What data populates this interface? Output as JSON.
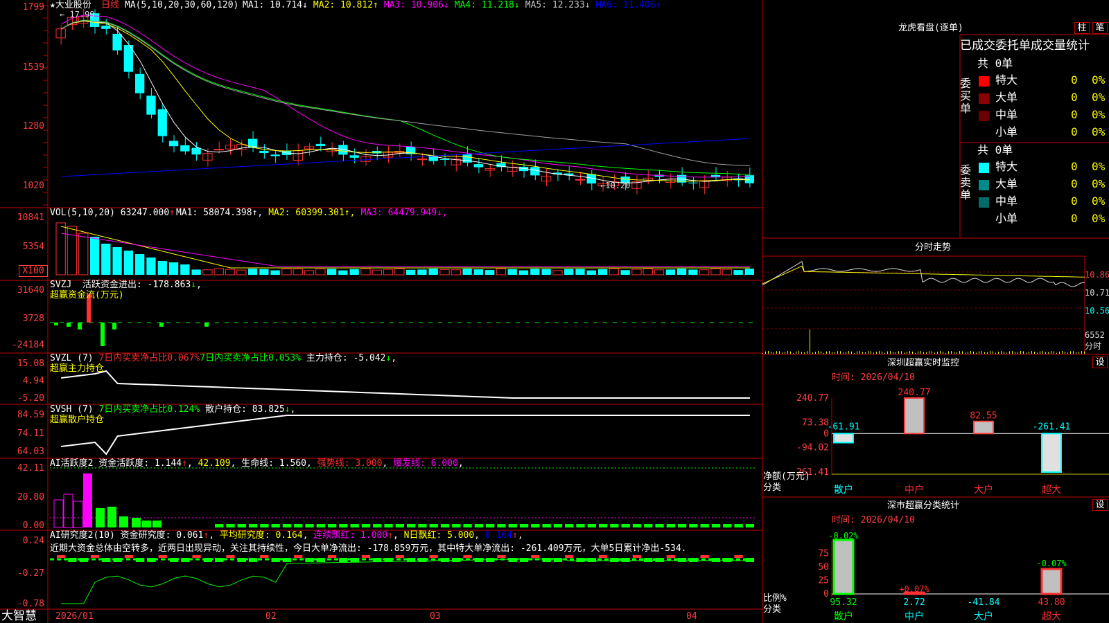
{
  "stock": {
    "name": "★大业股份",
    "period_label": "日线",
    "ma_params": "MA(5,10,20,30,60,120)"
  },
  "brand": "大智慧",
  "colors": {
    "up": "#ff3030",
    "down": "#00ffff",
    "bg": "#000000",
    "border": "#c00000",
    "axis_red": "#ff4040",
    "ma1": "#ffffff",
    "ma2": "#ffff00",
    "ma3": "#ff00ff",
    "ma4": "#00ff00",
    "ma5": "#a0a0a0",
    "ma6": "#0000ff"
  },
  "price_panel": {
    "labels": [
      {
        "name": "MA1",
        "text": "MA1: 10.714",
        "arrow": "↓",
        "color": "#ffffff"
      },
      {
        "name": "MA2",
        "text": "MA2: 10.812",
        "arrow": "↑",
        "color": "#ffff00"
      },
      {
        "name": "MA3",
        "text": "MA3: 10.906",
        "arrow": "↓",
        "color": "#ff00ff"
      },
      {
        "name": "MA4",
        "text": "MA4: 11.218",
        "arrow": "↓",
        "color": "#00ff00"
      },
      {
        "name": "MA5",
        "text": "MA5: 12.233",
        "arrow": "↓",
        "color": "#c0c0c0"
      },
      {
        "name": "MA6",
        "text": "MA6: 11.406",
        "arrow": "↑",
        "color": "#0000ff"
      }
    ],
    "axis_labels": [
      "1799",
      "1539",
      "1280",
      "1020"
    ],
    "high_annotation": "17.99",
    "low_annotation": "←10.20"
  },
  "vol_panel": {
    "header": "VOL(5,10,20)",
    "value": "63247.000",
    "value_arrow": "↑",
    "labels": [
      {
        "text": "MA1: 58074.398",
        "arrow": "↑",
        "color": "#ffffff"
      },
      {
        "text": "MA2: 60399.301",
        "arrow": "↑",
        "color": "#ffff00"
      },
      {
        "text": "MA3: 64479.949",
        "arrow": "↓",
        "color": "#ff00ff"
      }
    ],
    "axis_labels": [
      "10841",
      "5354",
      "X100"
    ]
  },
  "svzj_panel": {
    "header": "SVZJ",
    "main_label": "活跃资金进出: -178.863",
    "arrow": "↓",
    "sub_label": "超赢资金流(万元)",
    "axis_labels": [
      "31640",
      "3728",
      "-24184"
    ]
  },
  "svzl_panel": {
    "header": "SVZL (7)",
    "text1": "7日内买卖净占比0.067%",
    "text2": "7日内买卖净占比0.053%",
    "text3": "主力持仓: -5.042",
    "arrow": "↓",
    "sub_label": "超赢主力持仓",
    "axis_labels": [
      "15.08",
      "4.94",
      "-5.20"
    ]
  },
  "svsh_panel": {
    "header": "SVSH (7)",
    "text1": "7日内买卖净占比0.124%",
    "text2": "散户持仓: 83.825",
    "arrow": "↓",
    "sub_label": "超赢散户持仓",
    "axis_labels": [
      "84.59",
      "74.11",
      "64.03"
    ]
  },
  "ai_active_panel": {
    "header": "AI活跃度2",
    "text1": "资金活跃度: 1.144",
    "text2": "42.109",
    "text3": "生命线: 1.560",
    "text4": "强势线: 3.000",
    "text5": "爆发线: 6.000",
    "axis_labels": [
      "42.11",
      "20.80",
      "0.00"
    ]
  },
  "ai_research_panel": {
    "header": "AI研究度2(10)",
    "text1": "资金研究度: 0.061",
    "text2": "平均研究度: 0.164",
    "text3": "连续飘红: 1.000",
    "text4": "N日飘红: 5.000",
    "text5": "0.164",
    "comment": "近期大资金总体由空转多，近两日出现异动，关注其持续性，今日大单净流出: -178.859万元，其中特大单净流出: -261.409万元，大单5日累计净出-534.",
    "axis_labels": [
      "0.24",
      "-0.27",
      "-0.78"
    ]
  },
  "date_axis": [
    "2026/01",
    "02",
    "03",
    "04"
  ],
  "dragon_tiger": {
    "title": "龙虎看盘(逐单)",
    "btn1": "柱",
    "btn2": "笔",
    "section_title": "已成交委托单成交量统计",
    "buy_label": "委买单",
    "sell_label": "委卖单",
    "buy_total": "共 0单",
    "sell_total": "共 0单",
    "buy_rows": [
      {
        "label": "特大",
        "count": "0",
        "pct": "0%",
        "color": "#ff0000"
      },
      {
        "label": "大单",
        "count": "0",
        "pct": "0%",
        "color": "#8b0000"
      },
      {
        "label": "中单",
        "count": "0",
        "pct": "0%",
        "color": "#6b0000"
      },
      {
        "label": "小单",
        "count": "0",
        "pct": "0%",
        "color": "#000000"
      }
    ],
    "sell_rows": [
      {
        "label": "特大",
        "count": "0",
        "pct": "0%",
        "color": "#00ffff"
      },
      {
        "label": "大单",
        "count": "0",
        "pct": "0%",
        "color": "#008b8b"
      },
      {
        "label": "中单",
        "count": "0",
        "pct": "0%",
        "color": "#006b6b"
      },
      {
        "label": "小单",
        "count": "0",
        "pct": "0%",
        "color": "#000000"
      }
    ]
  },
  "intraday": {
    "title": "分时走势",
    "axis_labels": [
      "10.86",
      "10.71",
      "10.56",
      "6552"
    ],
    "unit_label": "分时"
  },
  "sz_monitor": {
    "title": "深圳超赢实时监控",
    "btn": "设",
    "time_label": "时间: 2026/04/10",
    "axis_labels": [
      "240.77",
      "73.38",
      "0",
      "-94.02",
      "-261.41"
    ],
    "y_title": "净额(万元)",
    "x_title": "分类"
  },
  "sz_class": {
    "title": "深市超赢分类统计",
    "btn": "设",
    "time_label": "时间: 2026/04/10",
    "axis_labels": [
      "75",
      "50",
      "25",
      "0"
    ],
    "y_title": "比例%",
    "x_title": "分类"
  },
  "chart_data": [
    {
      "type": "bar",
      "title": "深圳超赢实时监控",
      "ylabel": "净额(万元)",
      "xlabel": "分类",
      "categories": [
        "散户",
        "中户",
        "大户",
        "超大"
      ],
      "values": [
        -61.91,
        240.77,
        82.55,
        -261.41
      ],
      "ylim": [
        -261.41,
        240.77
      ]
    },
    {
      "type": "bar",
      "title": "深市超赢分类统计",
      "ylabel": "比例%",
      "xlabel": "分类",
      "categories": [
        "散户",
        "中户",
        "大户",
        "超大"
      ],
      "values": [
        95.32,
        2.72,
        -41.84,
        43.8
      ],
      "changes": [
        "-0.02%",
        "+0.07%",
        "",
        "-0.07%"
      ],
      "ylim": [
        0,
        100
      ]
    }
  ]
}
